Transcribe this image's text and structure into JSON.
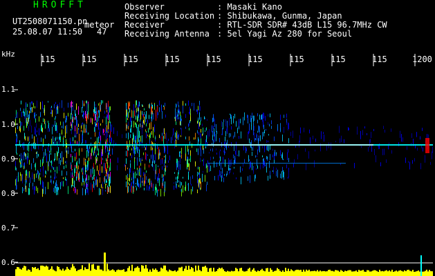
{
  "app": {
    "title": "HROFFT",
    "filename": "UT2508071150.pn",
    "mode": "meteor",
    "datetime": "25.08.07 11:50",
    "count": "47"
  },
  "info": [
    {
      "label": "Observer",
      "value": ": Masaki Kano"
    },
    {
      "label": "Receiving Location",
      "value": ": Shibukawa, Gunma, Japan"
    },
    {
      "label": "Receiver",
      "value": ": RTL-SDR SDR# 43dB L15 96.7MHz CW"
    },
    {
      "label": "Receiving Antenna",
      "value": ": 5el Yagi Az 280 for Seoul"
    }
  ],
  "time_axis": {
    "labels": [
      "115",
      "115",
      "115",
      "115",
      "115",
      "115",
      "115",
      "115",
      "115",
      "1200"
    ]
  },
  "freq_axis": {
    "unit": "kHz",
    "labels": [
      "1.1",
      "1.0",
      "0.9",
      "0.8",
      "0.7",
      "0.6"
    ]
  },
  "colors": {
    "background": "#000000",
    "title": "#00ff00",
    "text": "#ffffff",
    "signal": "#ffff00",
    "trace": "#00ffff"
  }
}
